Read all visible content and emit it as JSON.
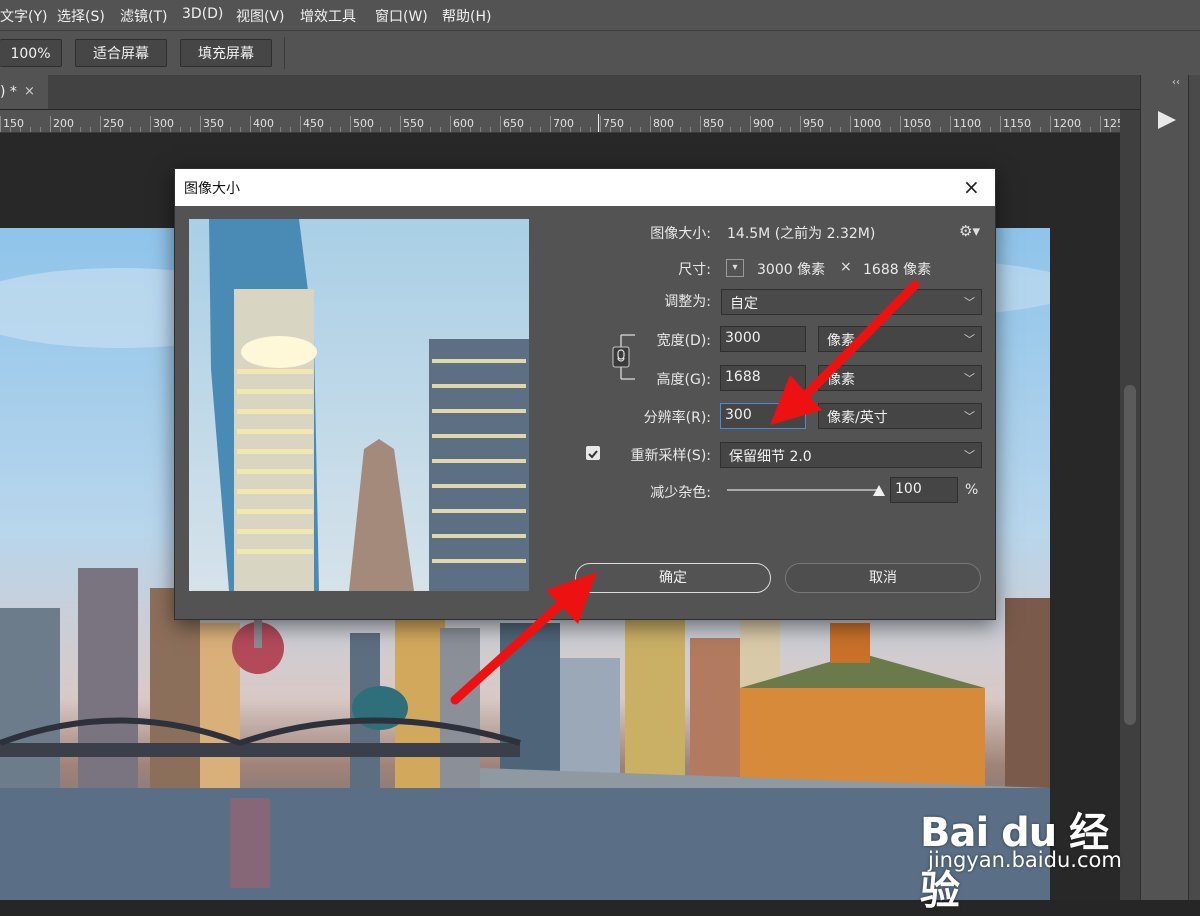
{
  "menu": {
    "items": [
      "文字(Y)",
      "选择(S)",
      "滤镜(T)",
      "3D(D)",
      "视图(V)",
      "增效工具",
      "窗口(W)",
      "帮助(H)"
    ]
  },
  "options_bar": {
    "zoom": "100%",
    "fit_screen": "适合屏幕",
    "fill_screen": "填充屏幕"
  },
  "document_tab": {
    "name": ") *",
    "close": "×"
  },
  "ruler": {
    "ticks": [
      "150",
      "200",
      "250",
      "300",
      "350",
      "400",
      "450",
      "500",
      "550",
      "600",
      "650",
      "700",
      "750",
      "800",
      "850",
      "900",
      "950",
      "1000",
      "1050",
      "1100",
      "1150",
      "1200",
      "125"
    ]
  },
  "dialog": {
    "title": "图像大小",
    "close": "×",
    "image_size_label": "图像大小:",
    "image_size_value": "14.5M (之前为 2.32M)",
    "dimensions_label": "尺寸:",
    "dimensions_width": "3000 像素",
    "dimensions_times": "×",
    "dimensions_height": "1688 像素",
    "fit_to_label": "调整为:",
    "fit_to_value": "自定",
    "width_label": "宽度(D):",
    "width_value": "3000",
    "width_unit": "像素",
    "height_label": "高度(G):",
    "height_value": "1688",
    "height_unit": "像素",
    "resolution_label": "分辨率(R):",
    "resolution_value": "300",
    "resolution_unit": "像素/英寸",
    "resample_label": "重新采样(S):",
    "resample_checked": true,
    "resample_value": "保留细节 2.0",
    "noise_label": "减少杂色:",
    "noise_value": "100",
    "noise_unit": "%",
    "noise_level_percent": 100,
    "ok": "确定",
    "cancel": "取消"
  },
  "watermark": {
    "logo": "Bai du 经验",
    "url": "jingyan.baidu.com"
  },
  "colors": {
    "ui_gray": "#535353",
    "canvas_bg": "#282828",
    "arrow_red": "#ee1111",
    "focus_blue": "#4a8bd6"
  }
}
